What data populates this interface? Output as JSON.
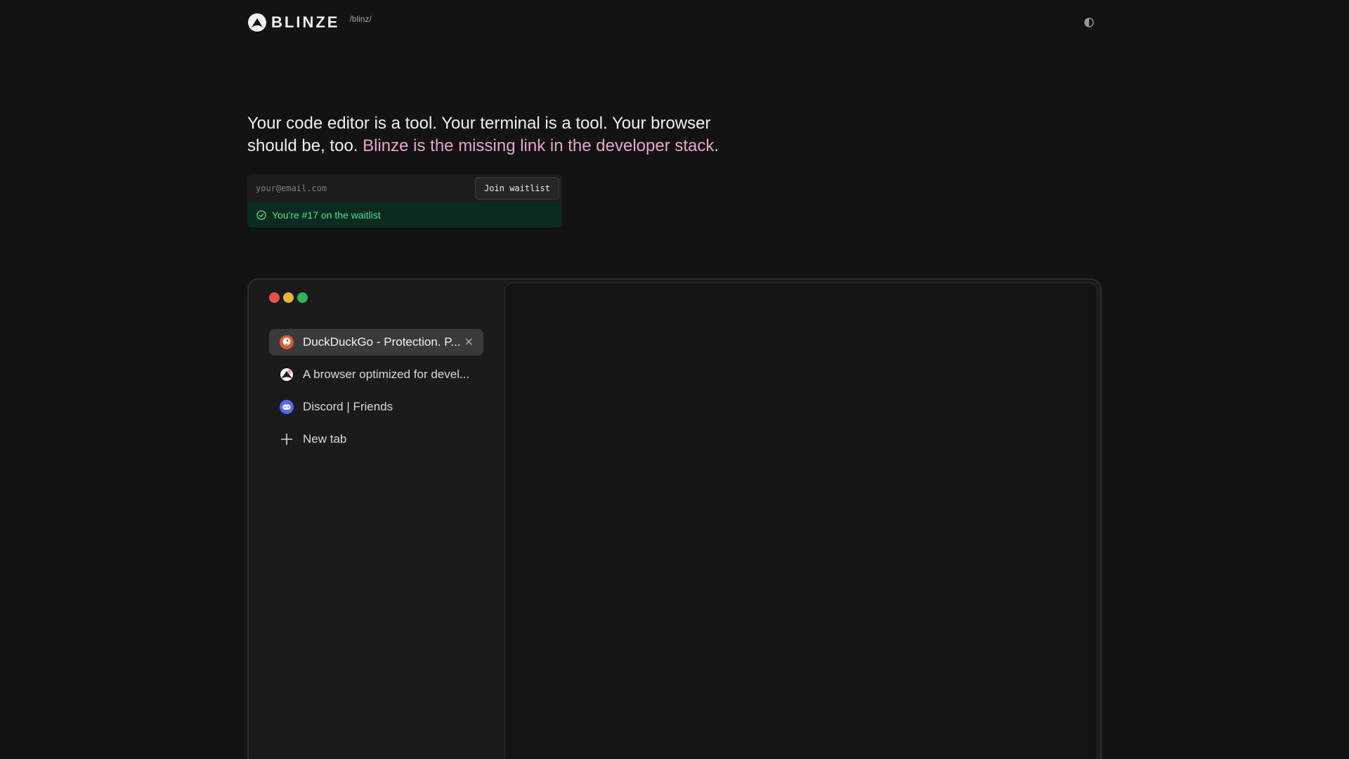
{
  "header": {
    "brand": "BLINZE",
    "slug": "/blinz/",
    "logo_icon": "blinze-logo-icon",
    "theme_toggle_icon": "contrast-icon"
  },
  "hero": {
    "text_plain": "Your code editor is a tool. Your terminal is a tool. Your browser should be, too. ",
    "text_accent": "Blinze is the missing link in the developer stack",
    "text_end": ".",
    "accent_color": "#e9a5c9"
  },
  "waitlist": {
    "email_value": "",
    "email_placeholder": "your@email.com",
    "button_label": "Join waitlist",
    "status_text": "You're #17 on the waitlist",
    "status_icon": "check-circle-icon",
    "status_color": "#4ee09a"
  },
  "browser": {
    "traffic_lights": [
      "#e5534b",
      "#e8b43a",
      "#2fb55a"
    ],
    "tabs": [
      {
        "label": "DuckDuckGo - Protection. P...",
        "icon": "duckduckgo-icon",
        "active": true,
        "closable": true
      },
      {
        "label": "A browser optimized for devel...",
        "icon": "blinze-favicon-icon",
        "active": false,
        "closable": false
      },
      {
        "label": "Discord | Friends",
        "icon": "discord-icon",
        "active": false,
        "closable": false
      },
      {
        "label": "New tab",
        "icon": "plus-icon",
        "active": false,
        "closable": false
      }
    ]
  }
}
